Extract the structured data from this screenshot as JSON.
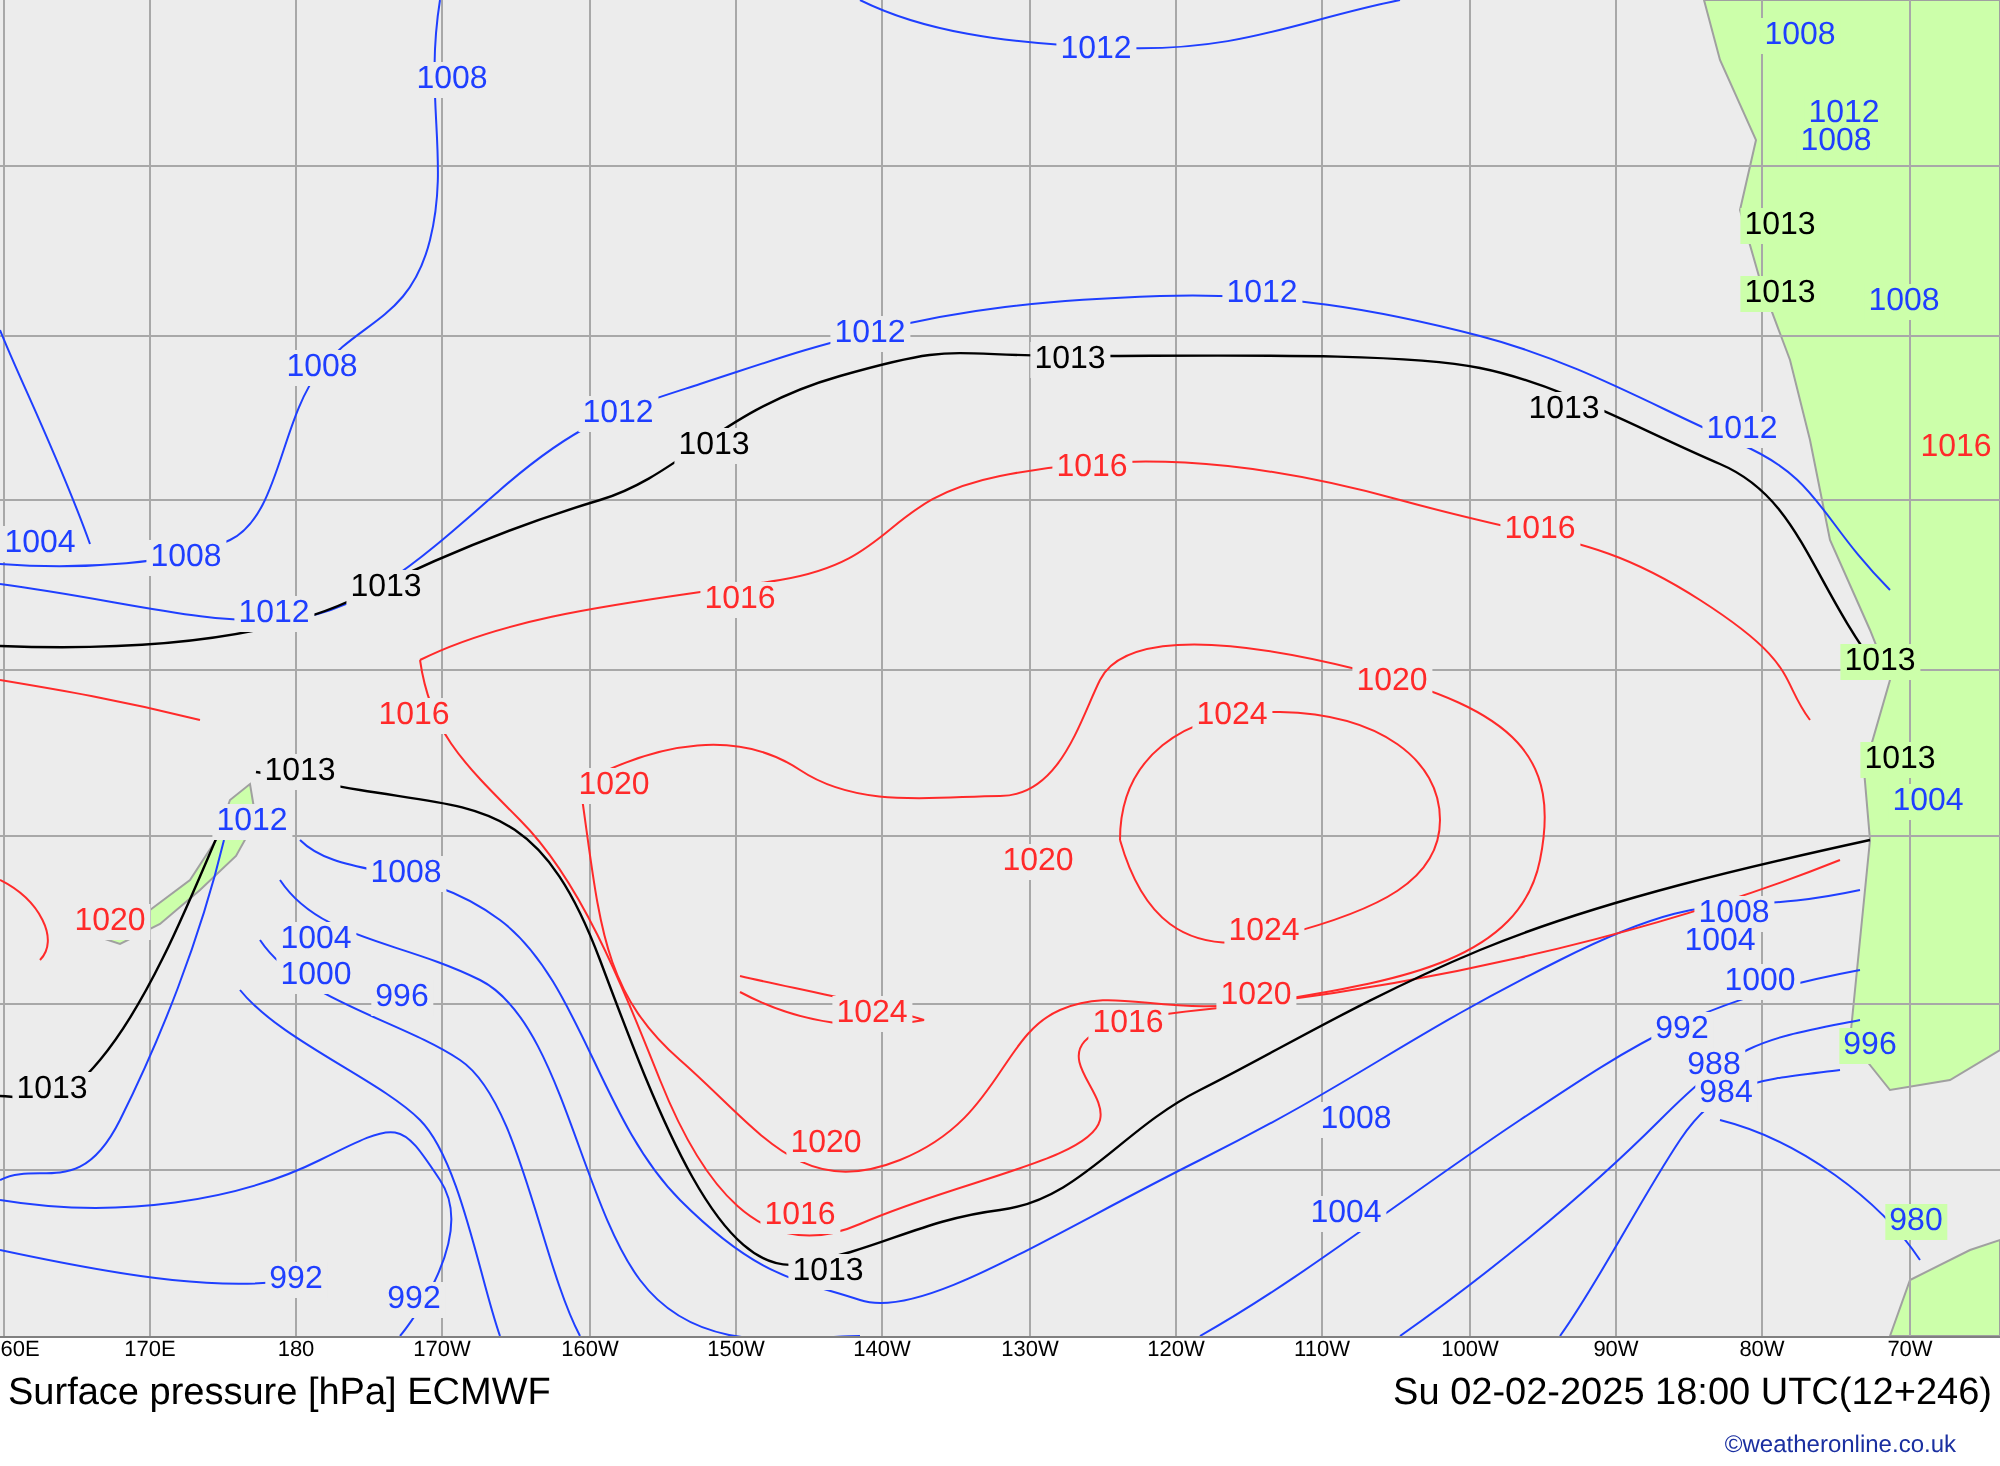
{
  "map": {
    "isobar_labels": [
      {
        "text": "1012",
        "kind": "low"
      },
      {
        "text": "1008",
        "kind": "low"
      },
      {
        "text": "1008",
        "kind": "low"
      },
      {
        "text": "1012",
        "kind": "low"
      },
      {
        "text": "1008",
        "kind": "low"
      },
      {
        "text": "1008",
        "kind": "low"
      },
      {
        "text": "1012",
        "kind": "low"
      },
      {
        "text": "1012",
        "kind": "low"
      },
      {
        "text": "1012",
        "kind": "low"
      },
      {
        "text": "1012",
        "kind": "low"
      },
      {
        "text": "1008",
        "kind": "low"
      },
      {
        "text": "1004",
        "kind": "low"
      },
      {
        "text": "1008",
        "kind": "low"
      },
      {
        "text": "1012",
        "kind": "low"
      },
      {
        "text": "1012",
        "kind": "low"
      },
      {
        "text": "1008",
        "kind": "low"
      },
      {
        "text": "1004",
        "kind": "low"
      },
      {
        "text": "1000",
        "kind": "low"
      },
      {
        "text": "996",
        "kind": "low"
      },
      {
        "text": "1008",
        "kind": "low"
      },
      {
        "text": "1004",
        "kind": "low"
      },
      {
        "text": "1000",
        "kind": "low"
      },
      {
        "text": "992",
        "kind": "low"
      },
      {
        "text": "988",
        "kind": "low"
      },
      {
        "text": "984",
        "kind": "low"
      },
      {
        "text": "996",
        "kind": "low"
      },
      {
        "text": "1008",
        "kind": "low"
      },
      {
        "text": "1004",
        "kind": "low"
      },
      {
        "text": "980",
        "kind": "low"
      },
      {
        "text": "992",
        "kind": "low"
      },
      {
        "text": "992",
        "kind": "low"
      },
      {
        "text": "1004",
        "kind": "low"
      },
      {
        "text": "1013",
        "kind": "standard"
      },
      {
        "text": "1013",
        "kind": "standard"
      },
      {
        "text": "1013",
        "kind": "standard"
      },
      {
        "text": "1013",
        "kind": "standard"
      },
      {
        "text": "1013",
        "kind": "standard"
      },
      {
        "text": "1013",
        "kind": "standard"
      },
      {
        "text": "1013",
        "kind": "standard"
      },
      {
        "text": "1013",
        "kind": "standard"
      },
      {
        "text": "1013",
        "kind": "standard"
      },
      {
        "text": "1013",
        "kind": "standard"
      },
      {
        "text": "1013",
        "kind": "standard"
      },
      {
        "text": "1016",
        "kind": "high"
      },
      {
        "text": "1016",
        "kind": "high"
      },
      {
        "text": "1016",
        "kind": "high"
      },
      {
        "text": "1016",
        "kind": "high"
      },
      {
        "text": "1016",
        "kind": "high"
      },
      {
        "text": "1016",
        "kind": "high"
      },
      {
        "text": "1016",
        "kind": "high"
      },
      {
        "text": "1020",
        "kind": "high"
      },
      {
        "text": "1020",
        "kind": "high"
      },
      {
        "text": "1020",
        "kind": "high"
      },
      {
        "text": "1020",
        "kind": "high"
      },
      {
        "text": "1020",
        "kind": "high"
      },
      {
        "text": "1020",
        "kind": "high"
      },
      {
        "text": "1024",
        "kind": "high"
      },
      {
        "text": "1024",
        "kind": "high"
      },
      {
        "text": "1024",
        "kind": "high"
      }
    ]
  },
  "axis": {
    "longitude_labels": [
      "60E",
      "170E",
      "180",
      "170W",
      "160W",
      "150W",
      "140W",
      "130W",
      "120W",
      "110W",
      "100W",
      "90W",
      "80W",
      "70W"
    ]
  },
  "footer": {
    "title": "Surface pressure [hPa] ECMWF",
    "datetime": "Su 02-02-2025 18:00 UTC(12+246)",
    "credit": "©weatheronline.co.uk"
  }
}
